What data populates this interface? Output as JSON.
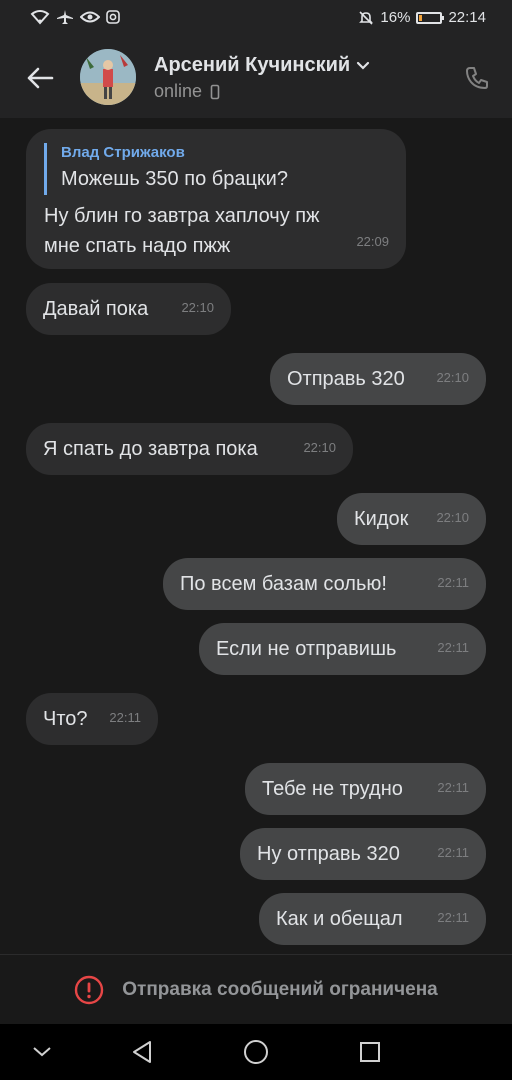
{
  "status_bar": {
    "battery": "16%",
    "battery_level": 0.16,
    "time": "22:14",
    "icons": [
      "wifi-icon",
      "airplane-icon",
      "eye-icon",
      "instagram-icon",
      "mute-icon",
      "battery-icon"
    ]
  },
  "header": {
    "contact_name": "Арсений Кучинский",
    "status": "online",
    "icons": [
      "back-arrow-icon",
      "chevron-down-icon",
      "phone-device-icon",
      "call-icon"
    ]
  },
  "messages": [
    {
      "direction": "in",
      "reply_author": "Влад Стрижаков",
      "reply_text": "Можешь 350 по брацки?",
      "text_lines": [
        "Ну блин го завтра хаплочу пж",
        "мне спать надо пжж"
      ],
      "time": "22:09"
    },
    {
      "direction": "in",
      "text": "Давай пока",
      "time": "22:10"
    },
    {
      "direction": "out",
      "text": "Отправь 320",
      "time": "22:10"
    },
    {
      "direction": "in",
      "text": "Я спать до завтра пока",
      "time": "22:10"
    },
    {
      "direction": "out",
      "text": "Кидок",
      "time": "22:10"
    },
    {
      "direction": "out",
      "text": "По всем базам солью!",
      "time": "22:11"
    },
    {
      "direction": "out",
      "text": "Если не отправишь",
      "time": "22:11"
    },
    {
      "direction": "in",
      "text": "Что?",
      "time": "22:11"
    },
    {
      "direction": "out",
      "text": "Тебе не трудно",
      "time": "22:11"
    },
    {
      "direction": "out",
      "text": "Ну отправь 320",
      "time": "22:11"
    },
    {
      "direction": "out",
      "text": "Как и обещал",
      "time": "22:11"
    }
  ],
  "restricted": {
    "text": "Отправка сообщений ограничена",
    "icon": "warning-icon",
    "color": "#e64646"
  },
  "nav": {
    "icons": [
      "hide-keyboard-icon",
      "back-triangle-icon",
      "home-circle-icon",
      "recents-square-icon"
    ]
  },
  "colors": {
    "background": "#191919",
    "bubble_in": "#2d2d2e",
    "bubble_out": "#454647",
    "accent": "#71aaeb"
  }
}
